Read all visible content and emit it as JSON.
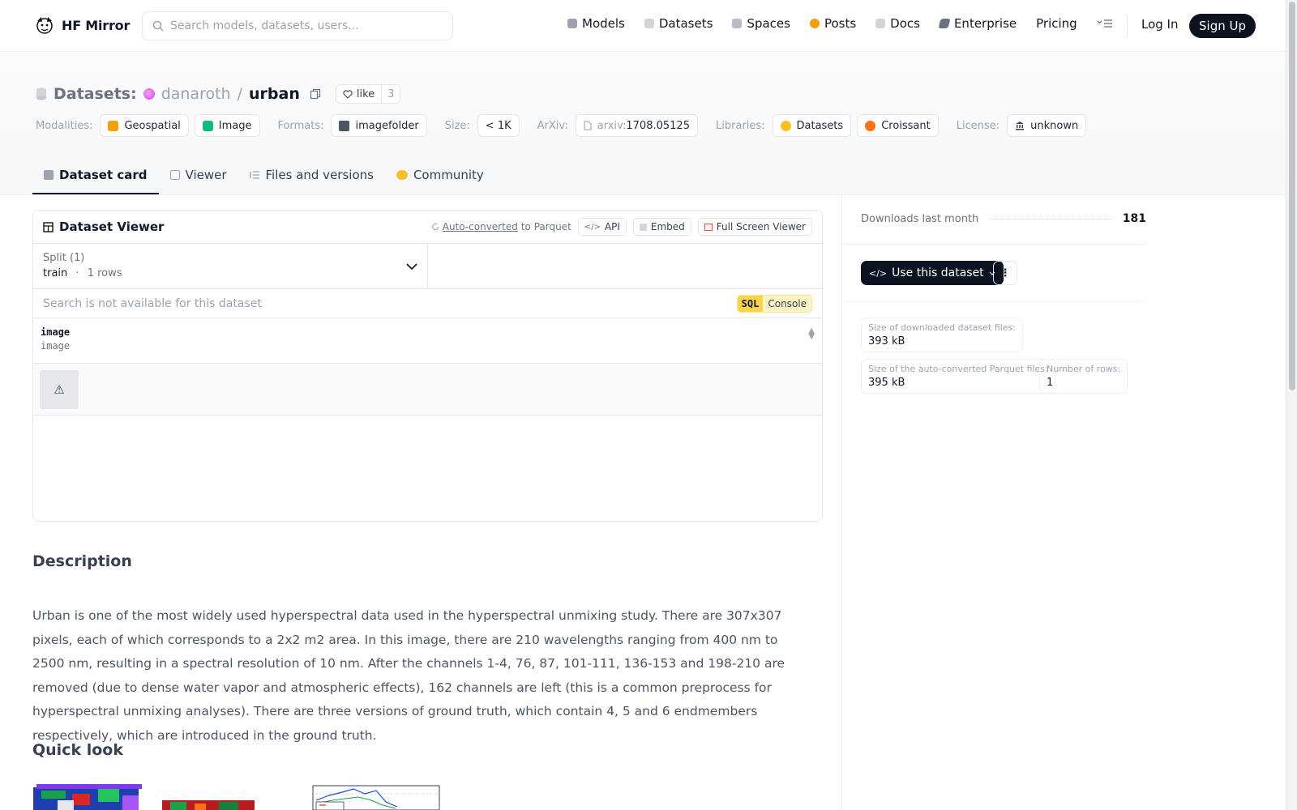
{
  "nav": {
    "brand": "HF Mirror",
    "search_placeholder": "Search models, datasets, users...",
    "links": [
      {
        "label": "Models",
        "icon": "cube-icon",
        "color": "#9ca3af"
      },
      {
        "label": "Datasets",
        "icon": "database-icon",
        "color": "#d1d5db"
      },
      {
        "label": "Spaces",
        "icon": "grid-icon",
        "color": "#9ca3af"
      },
      {
        "label": "Posts",
        "icon": "chat-bubble-icon",
        "color": "#f59e0b"
      },
      {
        "label": "Docs",
        "icon": "book-icon",
        "color": "#9ca3af"
      },
      {
        "label": "Enterprise",
        "icon": "tag-icon",
        "color": "#6b7280"
      },
      {
        "label": "Pricing",
        "icon": "",
        "color": ""
      }
    ],
    "login": "Log In",
    "signup": "Sign Up"
  },
  "header": {
    "section": "Datasets:",
    "owner": "danaroth",
    "sep": "/",
    "repo": "urban",
    "like_label": "like",
    "like_count": "3"
  },
  "meta": {
    "modalities_key": "Modalities:",
    "modalities": [
      {
        "label": "Geospatial",
        "color": "#f59e0b"
      },
      {
        "label": "Image",
        "color": "#10b981"
      }
    ],
    "formats_key": "Formats:",
    "format": "imagefolder",
    "size_key": "Size:",
    "size": "< 1K",
    "arxiv_key": "ArXiv:",
    "arxiv_prefix": "arxiv:",
    "arxiv_id": "1708.05125",
    "libraries_key": "Libraries:",
    "libraries": [
      {
        "label": "Datasets",
        "color": "#fbbf24"
      },
      {
        "label": "Croissant",
        "color": "#f97316"
      }
    ],
    "license_key": "License:",
    "license": "unknown"
  },
  "tabs": [
    {
      "label": "Dataset card",
      "active": true,
      "color": "#9ca3af"
    },
    {
      "label": "Viewer",
      "active": false,
      "color": "#d1d5db"
    },
    {
      "label": "Files and versions",
      "active": false,
      "color": "#d1d5db"
    },
    {
      "label": "Community",
      "active": false,
      "color": "#fbbf24"
    }
  ],
  "viewer": {
    "title": "Dataset Viewer",
    "auto_converted": "Auto-converted",
    "to_parquet": "to Parquet",
    "api": "API",
    "embed": "Embed",
    "full_screen": "Full Screen Viewer",
    "split_label": "Split (1)",
    "split_name": "train",
    "split_dot": "·",
    "split_rows": "1 rows",
    "search_placeholder": "Search is not available for this dataset",
    "sql_a": "SQL",
    "sql_b": "Console",
    "column_name": "image",
    "column_type": "image",
    "cell_icon": "⚠"
  },
  "description": {
    "heading": "Description",
    "text": "Urban is one of the most widely used hyperspectral data used in the hyperspectral unmixing study. There are 307x307 pixels, each of which corresponds to a 2x2 m2 area. In this image, there are 210 wavelengths ranging from 400 nm to 2500 nm, resulting in a spectral resolution of 10 nm. After the channels 1-4, 76, 87, 101-111, 136-153 and 198-210 are removed (due to dense water vapor and atmospheric effects), 162 channels are left (this is a common preprocess for hyperspectral unmixing analyses). There are three versions of ground truth, which contain 4, 5 and 6 endmembers respectively, which are introduced in the ground truth."
  },
  "quicklook": {
    "heading": "Quick look"
  },
  "sidebar": {
    "downloads_label": "Downloads last month",
    "downloads_value": "181",
    "use_dataset": "Use this dataset",
    "more": "⋮",
    "stats": [
      {
        "label": "Size of downloaded dataset files:",
        "value": "393 kB"
      },
      {
        "label": "Size of the auto-converted Parquet files:",
        "value": "395 kB"
      },
      {
        "label": "Number of rows:",
        "value": "1"
      }
    ]
  }
}
